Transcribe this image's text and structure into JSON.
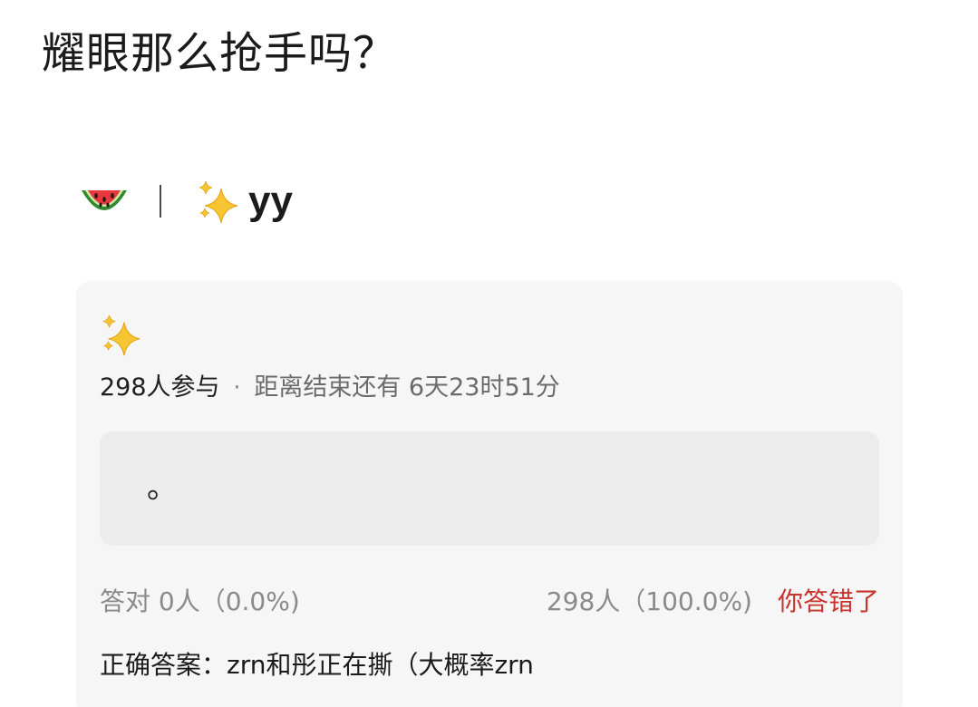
{
  "post": {
    "title": "耀眼那么抢手吗？",
    "author_name": "yy"
  },
  "icons": {
    "watermelon": "watermelon-icon",
    "sparkles": "sparkles-icon"
  },
  "quiz": {
    "participants": "298人参与",
    "separator": "·",
    "deadline": "距离结束还有 6天23时51分",
    "option_text": "。",
    "correct_stats": "答对  0人（0.0%)",
    "wrong_stats": "298人（100.0%)",
    "result_label": "你答错了",
    "answer_line": "正确答案：zrn和彤正在撕（大概率zrn"
  },
  "colors": {
    "card_bg": "#f6f6f6",
    "option_bg": "#ececec",
    "wrong_red": "#c8332b",
    "muted_text": "#8a8a8a"
  }
}
